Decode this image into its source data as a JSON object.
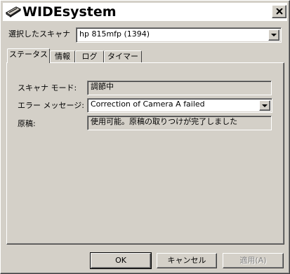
{
  "window": {
    "title": "WIDEsystem"
  },
  "scanner_select": {
    "label": "選択したスキャナ",
    "value": "hp 815mfp (1394)"
  },
  "tabs": [
    {
      "label": "ステータス",
      "active": true
    },
    {
      "label": "情報",
      "active": false
    },
    {
      "label": "ログ",
      "active": false
    },
    {
      "label": "タイマー",
      "active": false
    }
  ],
  "status": {
    "scanner_mode_label": "スキャナ モード:",
    "scanner_mode_value": "調節中",
    "error_label": "エラー メッセージ:",
    "error_value": "Correction of Camera A failed",
    "original_label": "原稿:",
    "original_value": "使用可能。原稿の取りつけが完了しました"
  },
  "buttons": {
    "ok": "OK",
    "cancel": "キャンセル",
    "apply": "適用(A)"
  },
  "icons": {
    "app": "scanner-icon",
    "close": "close-icon",
    "dropdown": "chevron-down-icon"
  }
}
